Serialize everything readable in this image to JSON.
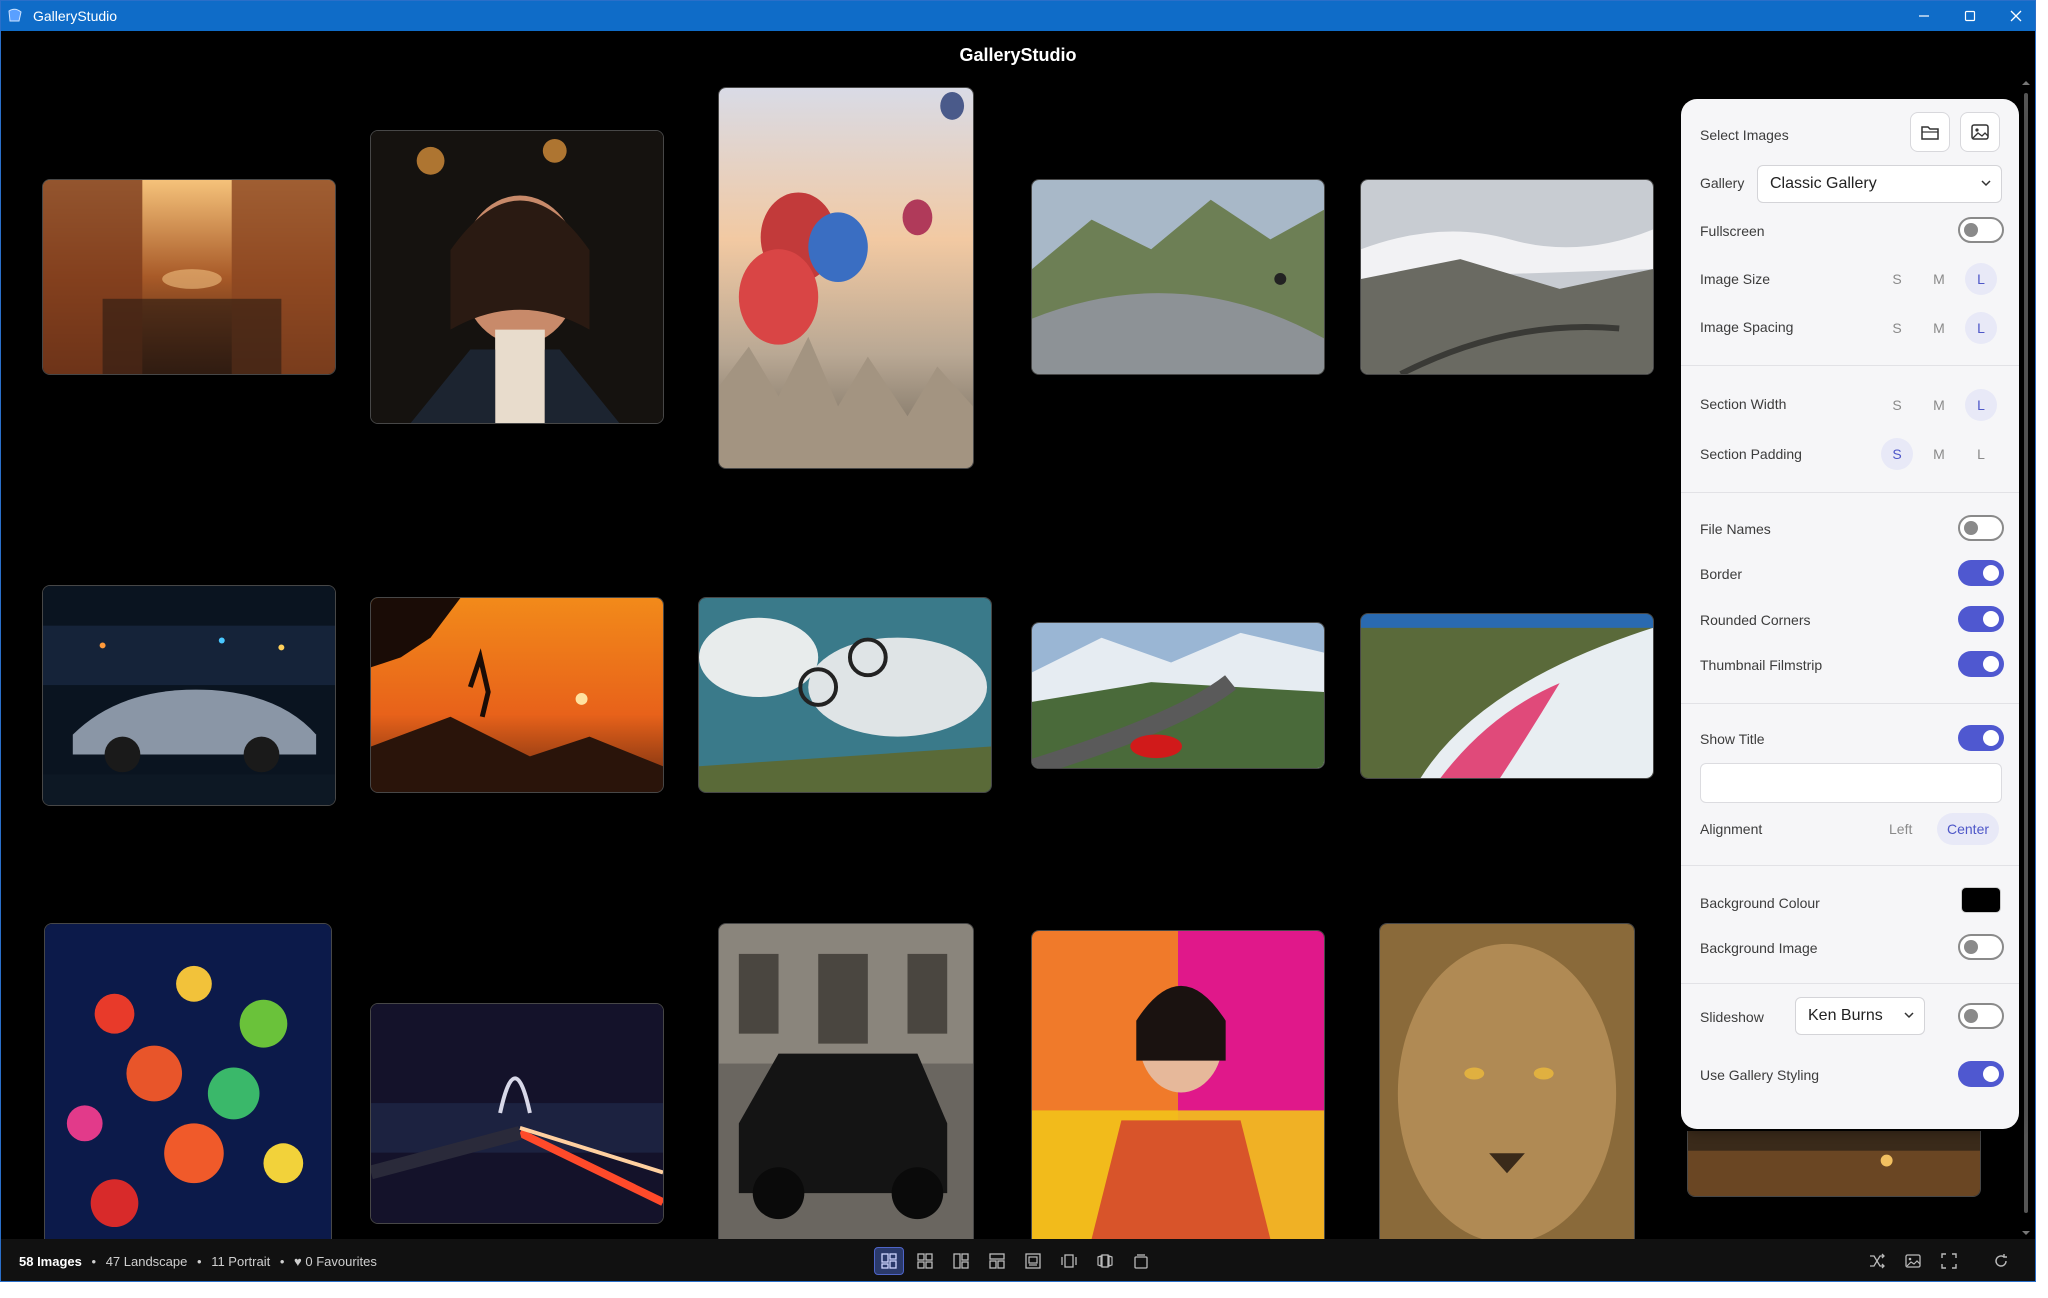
{
  "window": {
    "title": "GalleryStudio",
    "controls": [
      "minimize-icon",
      "maximize-icon",
      "close-icon"
    ]
  },
  "app": {
    "heading": "GalleryStudio"
  },
  "gallery": {
    "images": [
      {
        "subject": "venice-canal"
      },
      {
        "subject": "woman-portrait"
      },
      {
        "subject": "hot-air-balloons"
      },
      {
        "subject": "mountain-road-motorbike"
      },
      {
        "subject": "alpine-valley-road"
      },
      {
        "subject": "sports-car-night"
      },
      {
        "subject": "climber-sunset"
      },
      {
        "subject": "mountain-bike-jump"
      },
      {
        "subject": "red-car-mountain"
      },
      {
        "subject": "pink-lake-aerial"
      },
      {
        "subject": "lantern-festival"
      },
      {
        "subject": "night-bridge-light-trails"
      },
      {
        "subject": "vintage-car"
      },
      {
        "subject": "fashion-portrait"
      },
      {
        "subject": "lion-face"
      },
      {
        "subject": "dusk-waterfront"
      }
    ]
  },
  "panel": {
    "select_images": {
      "label": "Select Images",
      "folder_icon": "folder-icon",
      "image_icon": "image-icon"
    },
    "gallery": {
      "label": "Gallery",
      "value": "Classic Gallery"
    },
    "fullscreen": {
      "label": "Fullscreen",
      "on": false
    },
    "image_size": {
      "label": "Image Size",
      "options": [
        "S",
        "M",
        "L"
      ],
      "selected": "L"
    },
    "image_spacing": {
      "label": "Image Spacing",
      "options": [
        "S",
        "M",
        "L"
      ],
      "selected": "L"
    },
    "section_width": {
      "label": "Section Width",
      "options": [
        "S",
        "M",
        "L"
      ],
      "selected": "L"
    },
    "section_padding": {
      "label": "Section Padding",
      "options": [
        "S",
        "M",
        "L"
      ],
      "selected": "S"
    },
    "file_names": {
      "label": "File Names",
      "on": false
    },
    "border": {
      "label": "Border",
      "on": true
    },
    "rounded_corners": {
      "label": "Rounded Corners",
      "on": true
    },
    "thumbnail_filmstrip": {
      "label": "Thumbnail Filmstrip",
      "on": true
    },
    "show_title": {
      "label": "Show Title",
      "on": true,
      "value": ""
    },
    "alignment": {
      "label": "Alignment",
      "options": [
        "Left",
        "Center"
      ],
      "selected": "Center"
    },
    "background_colour": {
      "label": "Background Colour",
      "value": "#000000"
    },
    "background_image": {
      "label": "Background Image",
      "on": false
    },
    "slideshow": {
      "label": "Slideshow",
      "value": "Ken Burns",
      "on": false
    },
    "use_gallery_styling": {
      "label": "Use Gallery Styling",
      "on": true
    }
  },
  "status": {
    "count": "58 Images",
    "landscape": "47 Landscape",
    "portrait": "11 Portrait",
    "favourites": "0 Favourites",
    "bullet": "•",
    "heart": "♥",
    "layouts": [
      "layout-masonry-icon",
      "layout-grid-icon",
      "layout-mosaic-icon",
      "layout-rows-icon",
      "layout-spotlight-icon",
      "layout-carousel-icon",
      "layout-coverflow-icon",
      "layout-stack-icon"
    ],
    "active_layout": 0,
    "actions": [
      "shuffle-icon",
      "image-icon",
      "fullscreen-icon",
      "refresh-icon"
    ]
  },
  "colors": {
    "accent": "#4f58d0",
    "titlebar": "#0f6cc8",
    "background": "#000000",
    "panel": "#f6f6f8"
  }
}
